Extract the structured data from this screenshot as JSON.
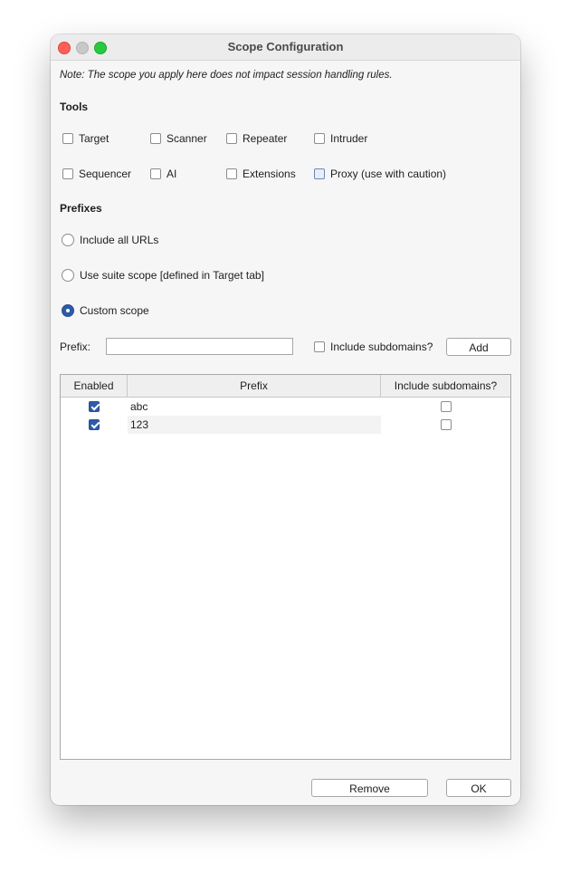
{
  "window": {
    "title": "Scope Configuration",
    "note": "Note: The scope you apply here does not impact session handling rules."
  },
  "tools": {
    "heading": "Tools",
    "items": [
      {
        "label": "Target",
        "checked": false
      },
      {
        "label": "Scanner",
        "checked": false
      },
      {
        "label": "Repeater",
        "checked": false
      },
      {
        "label": "Intruder",
        "checked": false
      },
      {
        "label": "Sequencer",
        "checked": false
      },
      {
        "label": "AI",
        "checked": false
      },
      {
        "label": "Extensions",
        "checked": false
      },
      {
        "label": "Proxy (use with caution)",
        "checked": false
      }
    ]
  },
  "prefixes": {
    "heading": "Prefixes",
    "options": [
      {
        "label": "Include all URLs",
        "selected": false
      },
      {
        "label": "Use suite scope [defined in Target tab]",
        "selected": false
      },
      {
        "label": "Custom scope",
        "selected": true
      }
    ],
    "prefix_label": "Prefix:",
    "prefix_value": "",
    "include_subdomains_label": "Include subdomains?",
    "add_label": "Add"
  },
  "table": {
    "columns": [
      "Enabled",
      "Prefix",
      "Include subdomains?"
    ],
    "rows": [
      {
        "enabled": true,
        "prefix": "abc",
        "include_subdomains": false
      },
      {
        "enabled": true,
        "prefix": "123",
        "include_subdomains": false
      }
    ]
  },
  "footer": {
    "remove_label": "Remove",
    "ok_label": "OK"
  },
  "colors": {
    "accent": "#2c5ba8",
    "close": "#ff5f57",
    "minimize": "#c8c8c8",
    "maximize": "#28c840"
  }
}
